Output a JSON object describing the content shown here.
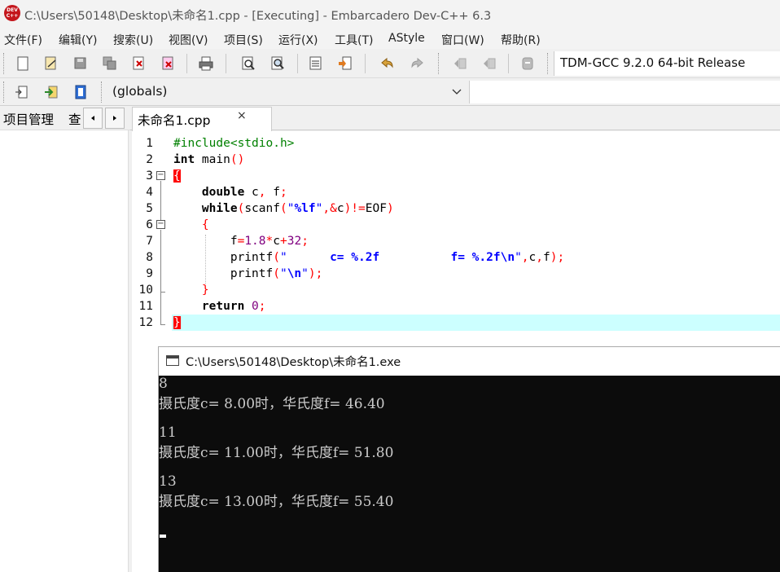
{
  "window": {
    "title": "C:\\Users\\50148\\Desktop\\未命名1.cpp - [Executing] - Embarcadero Dev-C++ 6.3",
    "icon_text": "DEV C++"
  },
  "menu": [
    "文件(F)",
    "编辑(Y)",
    "搜索(U)",
    "视图(V)",
    "项目(S)",
    "运行(X)",
    "工具(T)",
    "AStyle",
    "窗口(W)",
    "帮助(R)"
  ],
  "toolbar": {
    "compiler": "TDM-GCC 9.2.0 64-bit Release",
    "scope": "(globals)"
  },
  "left_panel": {
    "tab_project": "项目管理",
    "tab_view": "查"
  },
  "editor": {
    "tab_label": "未命名1.cpp",
    "tab_close": "×",
    "line_numbers": [
      "1",
      "2",
      "3",
      "4",
      "5",
      "6",
      "7",
      "8",
      "9",
      "10",
      "11",
      "12"
    ]
  },
  "console": {
    "title": "C:\\Users\\50148\\Desktop\\未命名1.exe",
    "lines": [
      "8",
      "摄氏度c= 8.00时，华氏度f= 46.40",
      "",
      "11",
      "摄氏度c= 11.00时，华氏度f= 51.80",
      "",
      "13",
      "摄氏度c= 13.00时，华氏度f= 55.40"
    ]
  },
  "colors": {
    "keyword": "#000000",
    "preprocessor": "#008000",
    "string": "#0000ff",
    "operator": "#ff0000",
    "number": "#800080",
    "current_line": "#ccffff",
    "console_bg": "#0c0c0c"
  }
}
